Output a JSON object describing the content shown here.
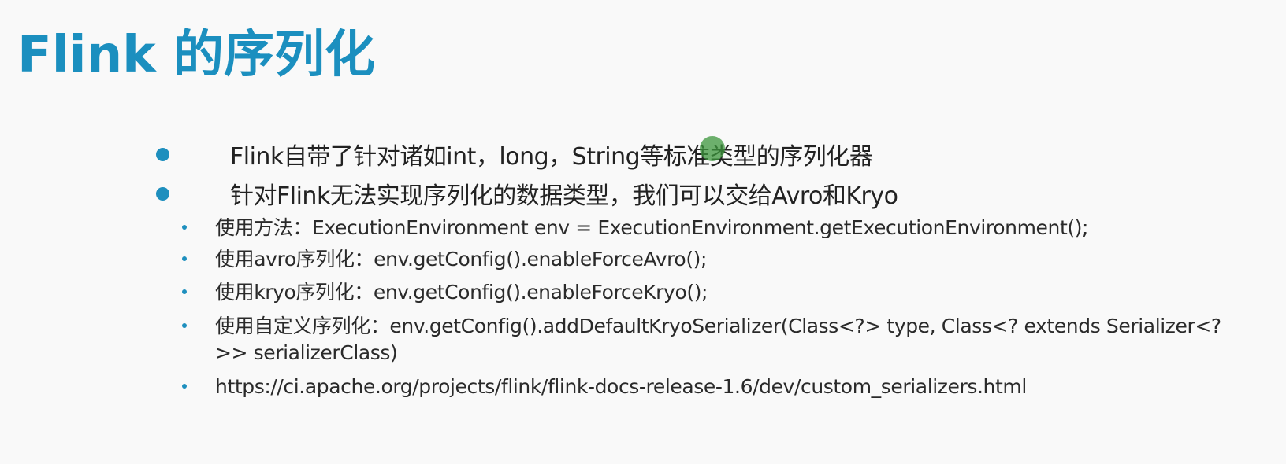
{
  "slide": {
    "title": "Flink 的序列化",
    "bullets": [
      {
        "text": "Flink自带了针对诸如int，long，String等标准类型的序列化器"
      },
      {
        "text": "针对Flink无法实现序列化的数据类型，我们可以交给Avro和Kryo"
      }
    ],
    "sub_bullets": [
      {
        "text": "使用方法：ExecutionEnvironment env = ExecutionEnvironment.getExecutionEnvironment();"
      },
      {
        "text": "使用avro序列化：env.getConfig().enableForceAvro();"
      },
      {
        "text": "使用kryo序列化：env.getConfig().enableForceKryo();"
      },
      {
        "text": "使用自定义序列化：env.getConfig().addDefaultKryoSerializer(Class<?> type, Class<? extends Serializer<?>> serializerClass)"
      },
      {
        "text": "https://ci.apache.org/projects/flink/flink-docs-release-1.6/dev/custom_serializers.html"
      }
    ]
  },
  "colors": {
    "title": "#1b8fbf",
    "bullet": "#1e8fbe",
    "text": "#222222",
    "background": "#f9f9f9",
    "cursor_highlight": "#3c963c"
  }
}
